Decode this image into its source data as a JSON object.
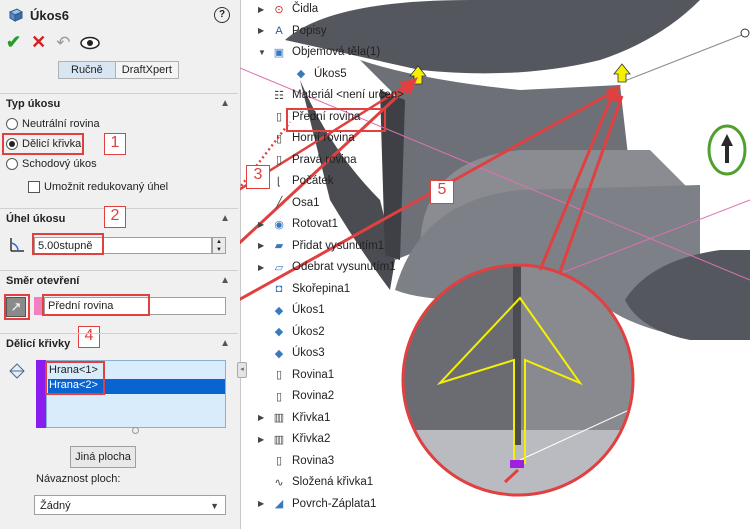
{
  "panel": {
    "title": "Úkos6",
    "help": "?",
    "tabs": [
      "Ručně",
      "DraftXpert"
    ],
    "draft_type": {
      "header": "Typ úkosu",
      "options": [
        "Neutrální rovina",
        "Dělicí křivka",
        "Schodový úkos"
      ],
      "selected": "Dělicí křivka",
      "checkbox": "Umožnit redukovaný úhel"
    },
    "draft_angle": {
      "header": "Úhel úkosu",
      "value": "5.00stupně"
    },
    "pull_direction": {
      "header": "Směr otevření",
      "value": "Přední rovina"
    },
    "parting_lines": {
      "header": "Dělicí křivky",
      "items": [
        "Hrana<1>",
        "Hrana<2>"
      ],
      "selected": "Hrana<2>"
    },
    "other_face_button": "Jiná plocha",
    "face_propagation": {
      "label": "Návaznost ploch:",
      "value": "Žádný"
    }
  },
  "tree": {
    "items": [
      {
        "label": "Čidla",
        "icon": "sensor-icon"
      },
      {
        "label": "Popisy",
        "icon": "annotations-icon"
      },
      {
        "label": "Objemová těla(1)",
        "icon": "solid-bodies-icon"
      },
      {
        "label": "Úkos5",
        "icon": "body-icon"
      },
      {
        "label": "Materiál <není určen>",
        "icon": "material-icon"
      },
      {
        "label": "Přední rovina",
        "icon": "plane-icon"
      },
      {
        "label": "Horní rovina",
        "icon": "plane-icon"
      },
      {
        "label": "Pravá rovina",
        "icon": "plane-icon"
      },
      {
        "label": "Počátek",
        "icon": "origin-icon"
      },
      {
        "label": "Osa1",
        "icon": "axis-icon"
      },
      {
        "label": "Rotovat1",
        "icon": "revolve-icon"
      },
      {
        "label": "Přidat vysunutím1",
        "icon": "extrude-icon"
      },
      {
        "label": "Odebrat vysunutím1",
        "icon": "cut-extrude-icon"
      },
      {
        "label": "Skořepina1",
        "icon": "shell-icon"
      },
      {
        "label": "Úkos1",
        "icon": "draft-icon"
      },
      {
        "label": "Úkos2",
        "icon": "draft-icon"
      },
      {
        "label": "Úkos3",
        "icon": "draft-icon"
      },
      {
        "label": "Rovina1",
        "icon": "plane-icon"
      },
      {
        "label": "Rovina2",
        "icon": "plane-icon"
      },
      {
        "label": "Křivka1",
        "icon": "curve-icon"
      },
      {
        "label": "Křivka2",
        "icon": "curve-icon"
      },
      {
        "label": "Rovina3",
        "icon": "plane-icon"
      },
      {
        "label": "Složená křivka1",
        "icon": "composite-curve-icon"
      },
      {
        "label": "Povrch-Záplata1",
        "icon": "surface-fill-icon"
      }
    ]
  },
  "callouts": [
    "1",
    "2",
    "3",
    "4",
    "5"
  ],
  "colors": {
    "accent_red": "#e04040",
    "selection_blue": "#0a64d0",
    "arrow_yellow": "#f5f000",
    "triad_green": "#50a030"
  }
}
